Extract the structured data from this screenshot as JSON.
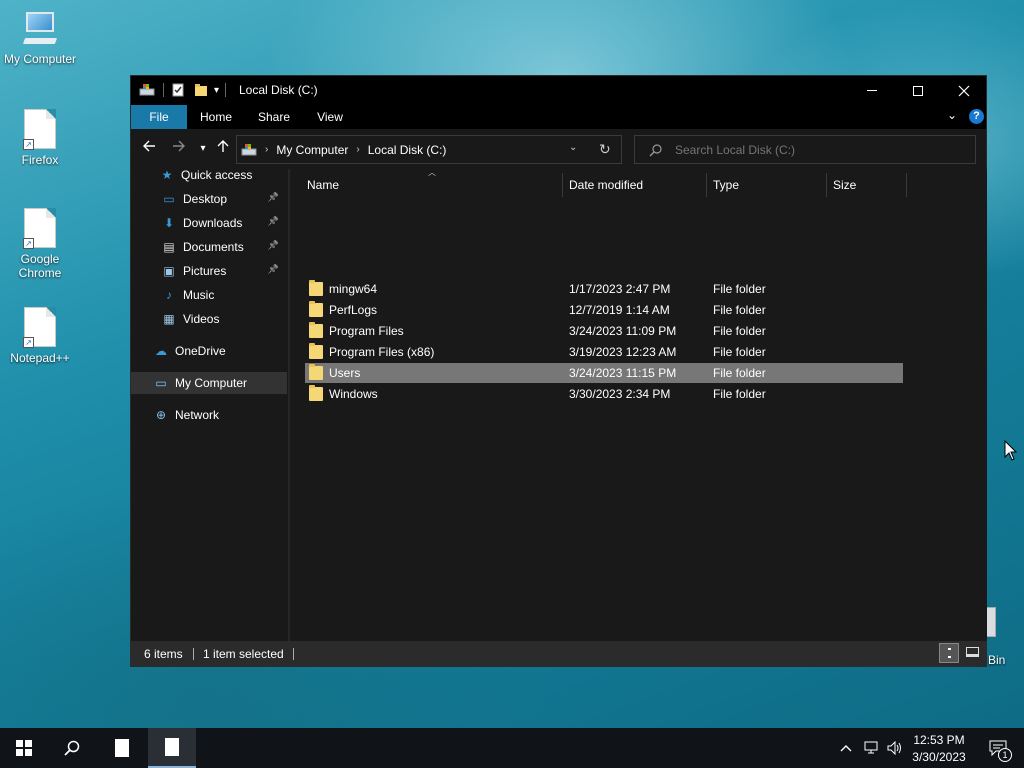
{
  "desktop": {
    "icons": [
      {
        "label": "My Computer"
      },
      {
        "label": "Firefox"
      },
      {
        "label": "Google Chrome"
      },
      {
        "label": "Notepad++"
      }
    ],
    "recycle_bin_label_partial": "Bin"
  },
  "window": {
    "title": "Local Disk (C:)",
    "ribbon_tabs": [
      "File",
      "Home",
      "Share",
      "View"
    ],
    "address": {
      "root_icon": "computer-drive-icon",
      "segments": [
        "My Computer",
        "Local Disk (C:)"
      ]
    },
    "search": {
      "placeholder": "Search Local Disk (C:)"
    },
    "sidebar": {
      "items": [
        {
          "label": "Quick access",
          "icon": "star-icon",
          "pinned": false
        },
        {
          "label": "Desktop",
          "icon": "desktop-icon",
          "pinned": true
        },
        {
          "label": "Downloads",
          "icon": "download-icon",
          "pinned": true
        },
        {
          "label": "Documents",
          "icon": "documents-icon",
          "pinned": true
        },
        {
          "label": "Pictures",
          "icon": "pictures-icon",
          "pinned": true
        },
        {
          "label": "Music",
          "icon": "music-icon",
          "pinned": false
        },
        {
          "label": "Videos",
          "icon": "videos-icon",
          "pinned": false
        },
        {
          "label": "OneDrive",
          "icon": "cloud-icon",
          "pinned": false
        },
        {
          "label": "My Computer",
          "icon": "computer-icon",
          "pinned": false,
          "selected": true
        },
        {
          "label": "Network",
          "icon": "network-icon",
          "pinned": false
        }
      ]
    },
    "columns": [
      "Name",
      "Date modified",
      "Type",
      "Size"
    ],
    "files": [
      {
        "name": "mingw64",
        "date": "1/17/2023 2:47 PM",
        "type": "File folder",
        "selected": false
      },
      {
        "name": "PerfLogs",
        "date": "12/7/2019 1:14 AM",
        "type": "File folder",
        "selected": false
      },
      {
        "name": "Program Files",
        "date": "3/24/2023 11:09 PM",
        "type": "File folder",
        "selected": false
      },
      {
        "name": "Program Files (x86)",
        "date": "3/19/2023 12:23 AM",
        "type": "File folder",
        "selected": false
      },
      {
        "name": "Users",
        "date": "3/24/2023 11:15 PM",
        "type": "File folder",
        "selected": true
      },
      {
        "name": "Windows",
        "date": "3/30/2023 2:34 PM",
        "type": "File folder",
        "selected": false
      }
    ],
    "status": {
      "items_count": "6 items",
      "selection": "1 item selected"
    }
  },
  "taskbar": {
    "time": "12:53 PM",
    "date": "3/30/2023",
    "notification_count": "1"
  },
  "colors": {
    "file_tab": "#1979a8",
    "selected_row": "#777777",
    "folder": "#f6d776"
  }
}
